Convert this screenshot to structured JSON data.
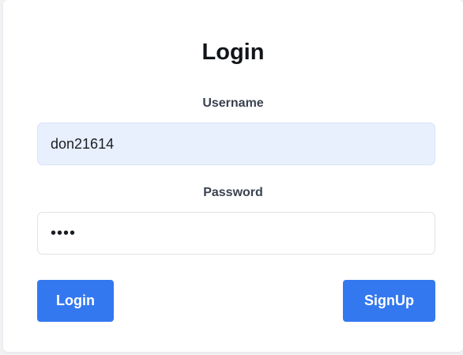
{
  "form": {
    "title": "Login",
    "username_label": "Username",
    "username_value": "don21614",
    "password_label": "Password",
    "password_value": "abcd",
    "login_button": "Login",
    "signup_button": "SignUp"
  },
  "colors": {
    "accent": "#3478f0",
    "autofill_bg": "#e8f0fe"
  }
}
